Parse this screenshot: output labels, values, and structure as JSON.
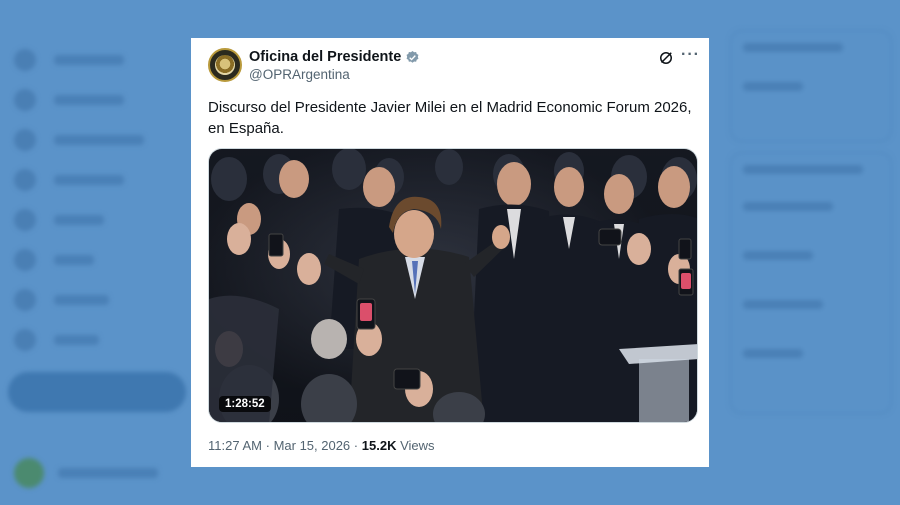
{
  "tweet": {
    "display_name": "Oficina del Presidente",
    "handle": "@OPRArgentina",
    "text": "Discurso del Presidente Javier Milei en el Madrid Economic Forum 2026, en España.",
    "video_duration": "1:28:52",
    "time": "11:27 AM",
    "separator": "·",
    "date": "Mar 15, 2026",
    "views_count": "15.2K",
    "views_label": "Views",
    "verified": true
  },
  "icons": {
    "verified": "verified-badge-icon",
    "grok": "grok-icon",
    "more": "more-icon"
  },
  "colors": {
    "background": "#5b93c9",
    "card": "#ffffff",
    "text": "#0f1419",
    "secondary": "#536471",
    "verified": "#829aab"
  }
}
